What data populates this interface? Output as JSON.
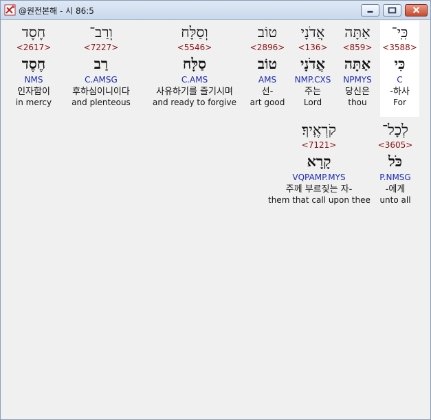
{
  "window": {
    "title": "@원전본해 - 시 86:5"
  },
  "rows": [
    {
      "words": [
        {
          "heb": "כִּֽי־",
          "strong": "<3588>",
          "lemma": "כִּי",
          "morph": "C",
          "kor": "-하사",
          "eng": "For",
          "selected": true
        },
        {
          "heb": "אַתָּה",
          "strong": "<859>",
          "lemma": "אַתָּה",
          "morph": "NPMYS",
          "kor": "당신은",
          "eng": "thou",
          "selected": false
        },
        {
          "heb": "אֲדֹנָי",
          "strong": "<136>",
          "lemma": "אֲדֹנָי",
          "morph": "NMP.CXS",
          "kor": "주는",
          "eng": "Lord",
          "selected": false
        },
        {
          "heb": "טוֹב",
          "strong": "<2896>",
          "lemma": "טוֹב",
          "morph": "AMS",
          "kor": "선-",
          "eng": "art good",
          "selected": false
        },
        {
          "heb": "וְסַלָּח",
          "strong": "<5546>",
          "lemma": "סַלָּח",
          "morph": "C.AMS",
          "kor": "사유하기를 즐기시며",
          "eng": "and ready to forgive",
          "selected": false
        },
        {
          "heb": "וְרַב־",
          "strong": "<7227>",
          "lemma": "רַב",
          "morph": "C.AMSG",
          "kor": "후하심이니이다",
          "eng": "and plenteous",
          "selected": false
        },
        {
          "heb": "חֶסֶד",
          "strong": "<2617>",
          "lemma": "חֶסֶד",
          "morph": "NMS",
          "kor": "인자함이",
          "eng": "in mercy",
          "selected": false
        }
      ]
    },
    {
      "words": [
        {
          "heb": "לְכָל־",
          "strong": "<3605>",
          "lemma": "כֹּל",
          "morph": "P.NMSG",
          "kor": "-에게",
          "eng": "unto all",
          "selected": false
        },
        {
          "heb": "קֹרְאֶֽיךָ׃",
          "strong": "<7121>",
          "lemma": "קָרָא",
          "morph": "VQPAMP.MYS",
          "kor": "주께 부르짖는 자-",
          "eng": "them that call upon thee",
          "selected": false
        }
      ]
    }
  ]
}
